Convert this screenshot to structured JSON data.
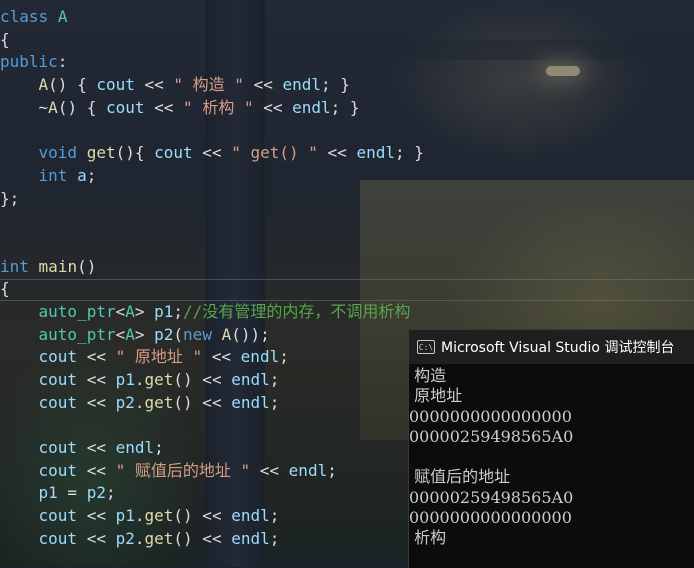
{
  "editor": {
    "lines": [
      [
        [
          "kw",
          "class"
        ],
        [
          "nm",
          " "
        ],
        [
          "cls",
          "A"
        ]
      ],
      [
        [
          "nm",
          "{"
        ]
      ],
      [
        [
          "kw",
          "public"
        ],
        [
          "nm",
          ":"
        ]
      ],
      [
        [
          "nm",
          "    "
        ],
        [
          "fn",
          "A"
        ],
        [
          "nm",
          "() { "
        ],
        [
          "vr",
          "cout"
        ],
        [
          "nm",
          " << "
        ],
        [
          "str",
          "\" 构造 \""
        ],
        [
          "nm",
          " << "
        ],
        [
          "vr",
          "endl"
        ],
        [
          "nm",
          "; }"
        ]
      ],
      [
        [
          "nm",
          "    ~"
        ],
        [
          "fn",
          "A"
        ],
        [
          "nm",
          "() { "
        ],
        [
          "vr",
          "cout"
        ],
        [
          "nm",
          " << "
        ],
        [
          "str",
          "\" 析构 \""
        ],
        [
          "nm",
          " << "
        ],
        [
          "vr",
          "endl"
        ],
        [
          "nm",
          "; }"
        ]
      ],
      [],
      [
        [
          "nm",
          "    "
        ],
        [
          "kw",
          "void"
        ],
        [
          "nm",
          " "
        ],
        [
          "fn",
          "get"
        ],
        [
          "nm",
          "(){ "
        ],
        [
          "vr",
          "cout"
        ],
        [
          "nm",
          " << "
        ],
        [
          "str",
          "\" get() \""
        ],
        [
          "nm",
          " << "
        ],
        [
          "vr",
          "endl"
        ],
        [
          "nm",
          "; }"
        ]
      ],
      [
        [
          "nm",
          "    "
        ],
        [
          "kw",
          "int"
        ],
        [
          "nm",
          " "
        ],
        [
          "vr",
          "a"
        ],
        [
          "nm",
          ";"
        ]
      ],
      [
        [
          "nm",
          "};"
        ]
      ],
      [],
      [],
      [
        [
          "kw",
          "int"
        ],
        [
          "nm",
          " "
        ],
        [
          "fn",
          "main"
        ],
        [
          "nm",
          "()"
        ]
      ],
      [
        [
          "nm",
          "{"
        ]
      ],
      [
        [
          "nm",
          "    "
        ],
        [
          "ty",
          "auto_ptr"
        ],
        [
          "nm",
          "<"
        ],
        [
          "cls",
          "A"
        ],
        [
          "nm",
          "> "
        ],
        [
          "vr",
          "p1"
        ],
        [
          "nm",
          ";"
        ],
        [
          "cm",
          "//没有管理的内存，不调用析构"
        ]
      ],
      [
        [
          "nm",
          "    "
        ],
        [
          "ty",
          "auto_ptr"
        ],
        [
          "nm",
          "<"
        ],
        [
          "cls",
          "A"
        ],
        [
          "nm",
          "> "
        ],
        [
          "vr",
          "p2"
        ],
        [
          "nm",
          "("
        ],
        [
          "kw",
          "new"
        ],
        [
          "nm",
          " "
        ],
        [
          "fn",
          "A"
        ],
        [
          "nm",
          "());"
        ]
      ],
      [
        [
          "nm",
          "    "
        ],
        [
          "vr",
          "cout"
        ],
        [
          "nm",
          " << "
        ],
        [
          "str",
          "\" 原地址 \""
        ],
        [
          "nm",
          " << "
        ],
        [
          "vr",
          "endl"
        ],
        [
          "nm",
          ";"
        ]
      ],
      [
        [
          "nm",
          "    "
        ],
        [
          "vr",
          "cout"
        ],
        [
          "nm",
          " << "
        ],
        [
          "vr",
          "p1"
        ],
        [
          "nm",
          "."
        ],
        [
          "fn",
          "get"
        ],
        [
          "nm",
          "() << "
        ],
        [
          "vr",
          "endl"
        ],
        [
          "nm",
          ";"
        ]
      ],
      [
        [
          "nm",
          "    "
        ],
        [
          "vr",
          "cout"
        ],
        [
          "nm",
          " << "
        ],
        [
          "vr",
          "p2"
        ],
        [
          "nm",
          "."
        ],
        [
          "fn",
          "get"
        ],
        [
          "nm",
          "() << "
        ],
        [
          "vr",
          "endl"
        ],
        [
          "nm",
          ";"
        ]
      ],
      [],
      [
        [
          "nm",
          "    "
        ],
        [
          "vr",
          "cout"
        ],
        [
          "nm",
          " << "
        ],
        [
          "vr",
          "endl"
        ],
        [
          "nm",
          ";"
        ]
      ],
      [
        [
          "nm",
          "    "
        ],
        [
          "vr",
          "cout"
        ],
        [
          "nm",
          " << "
        ],
        [
          "str",
          "\" 赋值后的地址 \""
        ],
        [
          "nm",
          " << "
        ],
        [
          "vr",
          "endl"
        ],
        [
          "nm",
          ";"
        ]
      ],
      [
        [
          "nm",
          "    "
        ],
        [
          "vr",
          "p1"
        ],
        [
          "nm",
          " = "
        ],
        [
          "vr",
          "p2"
        ],
        [
          "nm",
          ";"
        ]
      ],
      [
        [
          "nm",
          "    "
        ],
        [
          "vr",
          "cout"
        ],
        [
          "nm",
          " << "
        ],
        [
          "vr",
          "p1"
        ],
        [
          "nm",
          "."
        ],
        [
          "fn",
          "get"
        ],
        [
          "nm",
          "() << "
        ],
        [
          "vr",
          "endl"
        ],
        [
          "nm",
          ";"
        ]
      ],
      [
        [
          "nm",
          "    "
        ],
        [
          "vr",
          "cout"
        ],
        [
          "nm",
          " << "
        ],
        [
          "vr",
          "p2"
        ],
        [
          "nm",
          "."
        ],
        [
          "fn",
          "get"
        ],
        [
          "nm",
          "() << "
        ],
        [
          "vr",
          "endl"
        ],
        [
          "nm",
          ";"
        ]
      ]
    ]
  },
  "console": {
    "title": "Microsoft Visual Studio 调试控制台",
    "icon": "console-app-icon",
    "output": [
      " 构造",
      " 原地址",
      "0000000000000000",
      "00000259498565A0",
      "",
      " 赋值后的地址",
      "00000259498565A0",
      "0000000000000000",
      " 析构"
    ]
  }
}
